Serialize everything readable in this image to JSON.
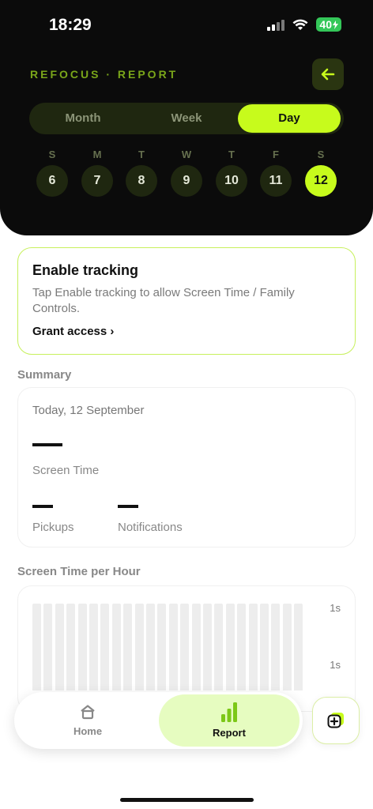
{
  "status_bar": {
    "time": "18:29",
    "battery": "40"
  },
  "header": {
    "app_title": "REFOCUS · REPORT"
  },
  "segments": [
    {
      "label": "Month",
      "active": false
    },
    {
      "label": "Week",
      "active": false
    },
    {
      "label": "Day",
      "active": true
    }
  ],
  "days": [
    {
      "letter": "S",
      "num": "6"
    },
    {
      "letter": "M",
      "num": "7"
    },
    {
      "letter": "T",
      "num": "8"
    },
    {
      "letter": "W",
      "num": "9"
    },
    {
      "letter": "T",
      "num": "10"
    },
    {
      "letter": "F",
      "num": "11"
    },
    {
      "letter": "S",
      "num": "12",
      "active": true
    }
  ],
  "tracking": {
    "title": "Enable tracking",
    "description": "Tap Enable tracking to allow Screen Time / Family Controls.",
    "link": "Grant access ›"
  },
  "summary": {
    "section_label": "Summary",
    "date": "Today, 12 September",
    "screen_time_label": "Screen Time",
    "pickups_label": "Pickups",
    "notifications_label": "Notifications"
  },
  "per_hour": {
    "section_label": "Screen Time per Hour",
    "tick_top": "1s",
    "tick_mid": "1s",
    "bar_count": 24
  },
  "tabbar": {
    "home_label": "Home",
    "report_label": "Report"
  },
  "colors": {
    "accent": "#c7fb1c",
    "header_bg": "#0b0b0b",
    "title_green": "#7aa61a",
    "report_tab_bg": "#e6fcc0"
  }
}
